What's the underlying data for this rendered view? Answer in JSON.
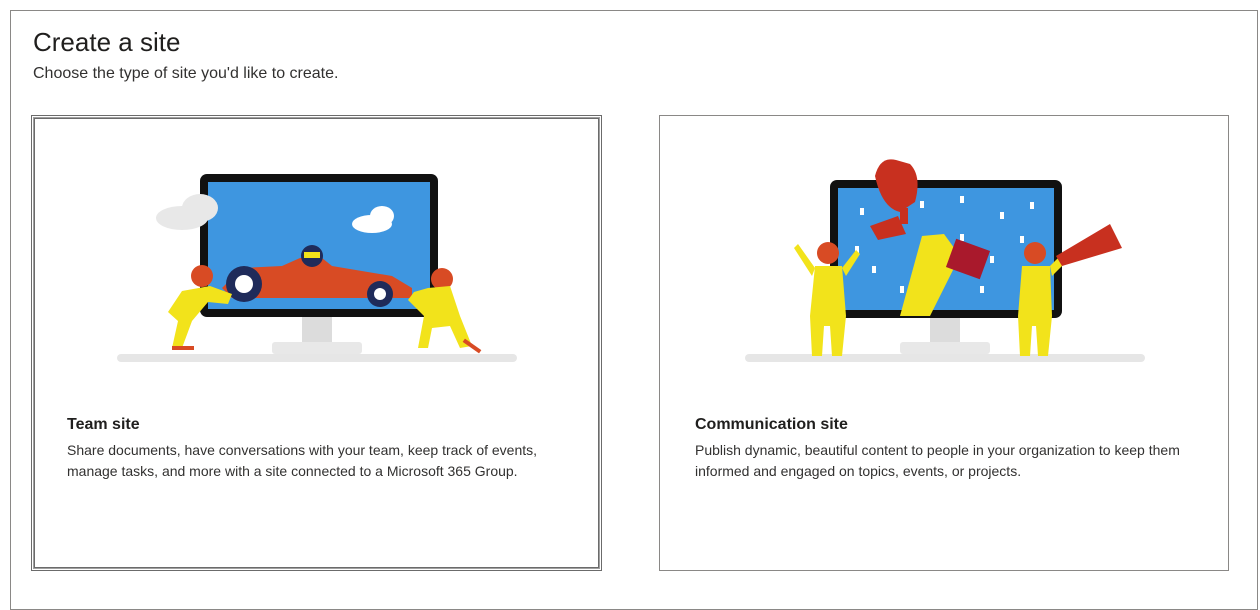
{
  "page": {
    "title": "Create a site",
    "subtitle": "Choose the type of site you'd like to create."
  },
  "cards": [
    {
      "title": "Team site",
      "description": "Share documents, have conversations with your team, keep track of events, manage tasks, and more with a site connected to a Microsoft 365 Group.",
      "selected": true,
      "illustration": "team-site-illustration"
    },
    {
      "title": "Communication site",
      "description": "Publish dynamic, beautiful content to people in your organization to keep them informed and engaged on topics, events, or projects.",
      "selected": false,
      "illustration": "communication-site-illustration"
    }
  ],
  "colors": {
    "screen_blue": "#3e96e0",
    "figure_yellow": "#f2e31b",
    "helmet_orange": "#d84b24",
    "trophy_red": "#c8301f"
  }
}
